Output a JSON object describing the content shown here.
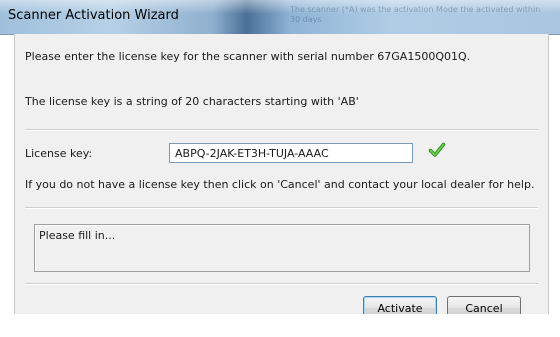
{
  "window": {
    "title": "Scanner Activation Wizard",
    "background_hint": "The scanner (*A) was the activation Mode the activated within 30 days"
  },
  "content": {
    "intro": "Please enter the license key for the scanner with serial number 67GA1500Q01Q.",
    "format_hint": "The license key is a string of 20 characters starting with 'AB'",
    "license_label": "License key:",
    "license_value": "ABPQ-2JAK-ET3H-TUJA-AAAC",
    "help_text": "If you do not have a license key then click on 'Cancel' and contact your local dealer for help."
  },
  "status": {
    "message": "Please fill in..."
  },
  "buttons": {
    "activate": "Activate",
    "cancel": "Cancel"
  },
  "colors": {
    "check": "#3aa52a",
    "accent_border": "#3c7fb1"
  },
  "icons": {
    "check": "check-icon"
  }
}
